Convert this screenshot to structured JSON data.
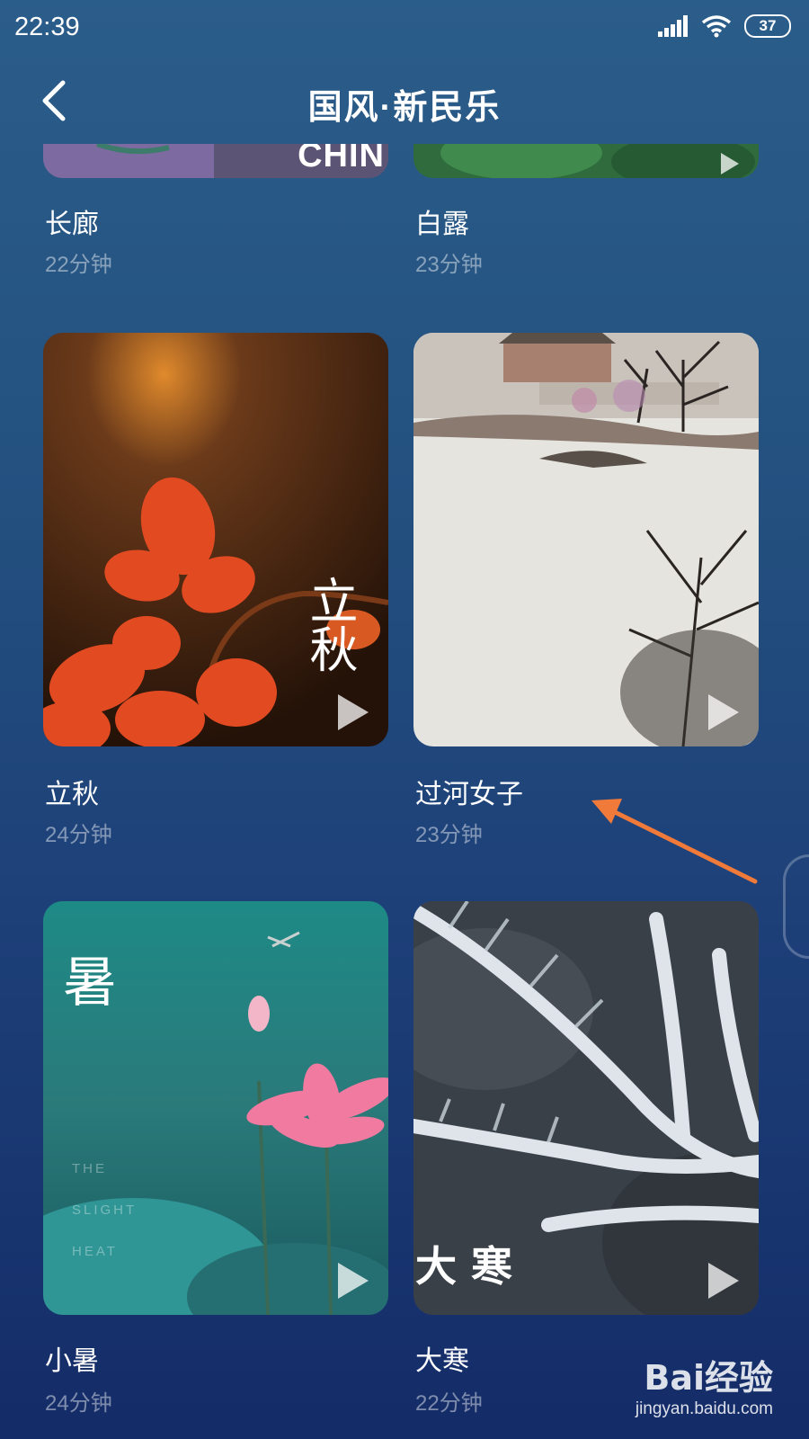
{
  "status_bar": {
    "time": "22:39",
    "battery": "37",
    "icons": [
      "signal-icon",
      "wifi-icon",
      "battery-icon"
    ]
  },
  "header": {
    "title": "国风·新民乐",
    "back_icon": "chevron-left-icon"
  },
  "items": [
    {
      "title": "长廊",
      "duration": "22分钟",
      "overlay": "CHIN"
    },
    {
      "title": "白露",
      "duration": "23分钟"
    },
    {
      "title": "立秋",
      "duration": "24分钟",
      "overlay": "立秋"
    },
    {
      "title": "过河女子",
      "duration": "23分钟"
    },
    {
      "title": "小暑",
      "duration": "24分钟",
      "overlay": "暑",
      "overlay_sub": [
        "THE",
        "SLIGHT",
        "HEAT"
      ]
    },
    {
      "title": "大寒",
      "duration": "22分钟",
      "overlay": "大 寒"
    }
  ],
  "annotation": {
    "color": "#f07a3a"
  },
  "watermark": {
    "logo": "Bai经验",
    "url": "jingyan.baidu.com"
  }
}
